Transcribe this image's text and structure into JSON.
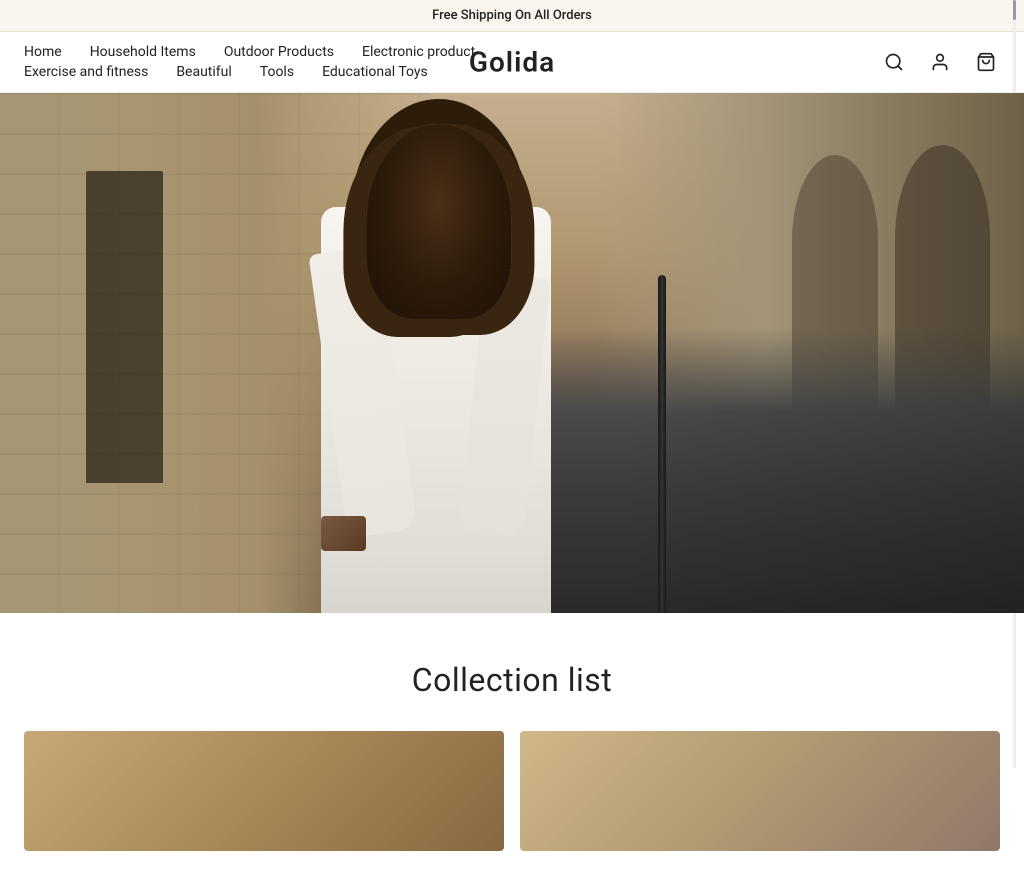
{
  "announcement": {
    "text": "Free Shipping On All Orders"
  },
  "logo": {
    "text": "Golida"
  },
  "nav": {
    "row1": [
      {
        "label": "Home",
        "id": "home"
      },
      {
        "label": "Household Items",
        "id": "household-items"
      },
      {
        "label": "Outdoor Products",
        "id": "outdoor-products"
      },
      {
        "label": "Electronic product",
        "id": "electronic-product"
      }
    ],
    "row2": [
      {
        "label": "Exercise and fitness",
        "id": "exercise-fitness"
      },
      {
        "label": "Beautiful",
        "id": "beautiful"
      },
      {
        "label": "Tools",
        "id": "tools"
      },
      {
        "label": "Educational Toys",
        "id": "educational-toys"
      }
    ]
  },
  "icons": {
    "search": "search-icon",
    "account": "account-icon",
    "cart": "cart-icon"
  },
  "collection": {
    "title": "Collection list"
  }
}
